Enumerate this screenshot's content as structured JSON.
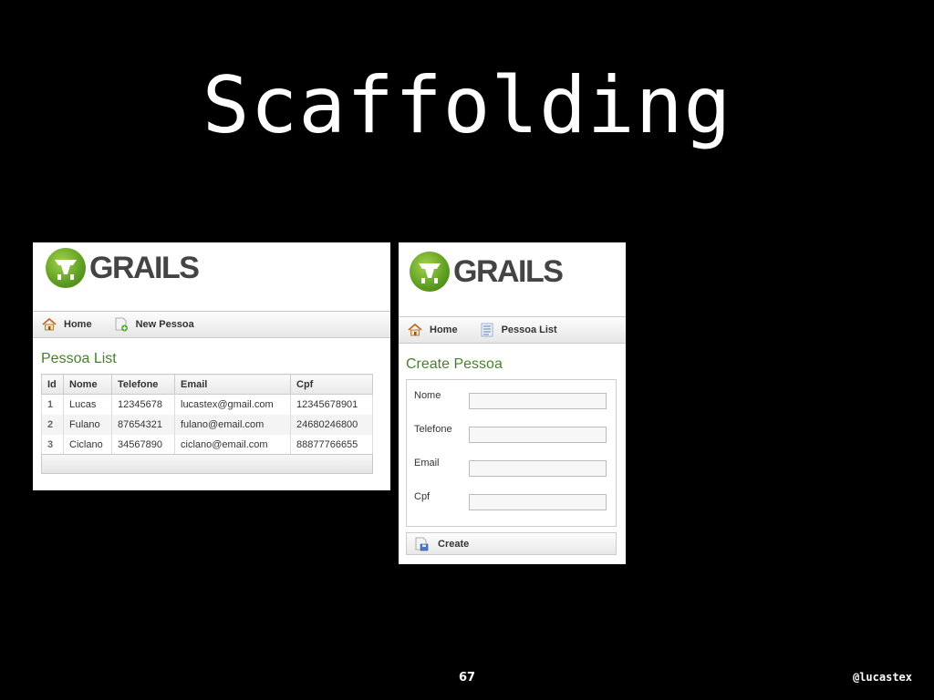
{
  "slide": {
    "title": "Scaffolding",
    "page_number": "67",
    "handle": "@lucastex"
  },
  "list_panel": {
    "logo_text": "GRAILS",
    "nav": [
      {
        "label": "Home",
        "icon": "home-icon"
      },
      {
        "label": "New Pessoa",
        "icon": "new-document-icon"
      }
    ],
    "heading": "Pessoa List",
    "table": {
      "headers": [
        "Id",
        "Nome",
        "Telefone",
        "Email",
        "Cpf"
      ],
      "rows": [
        [
          "1",
          "Lucas",
          "12345678",
          "lucastex@gmail.com",
          "12345678901"
        ],
        [
          "2",
          "Fulano",
          "87654321",
          "fulano@email.com",
          "24680246800"
        ],
        [
          "3",
          "Ciclano",
          "34567890",
          "ciclano@email.com",
          "88877766655"
        ]
      ]
    }
  },
  "create_panel": {
    "logo_text": "GRAILS",
    "nav": [
      {
        "label": "Home",
        "icon": "home-icon"
      },
      {
        "label": "Pessoa List",
        "icon": "list-icon"
      }
    ],
    "heading": "Create Pessoa",
    "fields": [
      {
        "label": "Nome",
        "value": ""
      },
      {
        "label": "Telefone",
        "value": ""
      },
      {
        "label": "Email",
        "value": ""
      },
      {
        "label": "Cpf",
        "value": ""
      }
    ],
    "button": {
      "label": "Create",
      "icon": "save-icon"
    }
  },
  "colors": {
    "background": "#000000",
    "heading_green": "#48802c",
    "logo_green": "#5d9d22"
  }
}
